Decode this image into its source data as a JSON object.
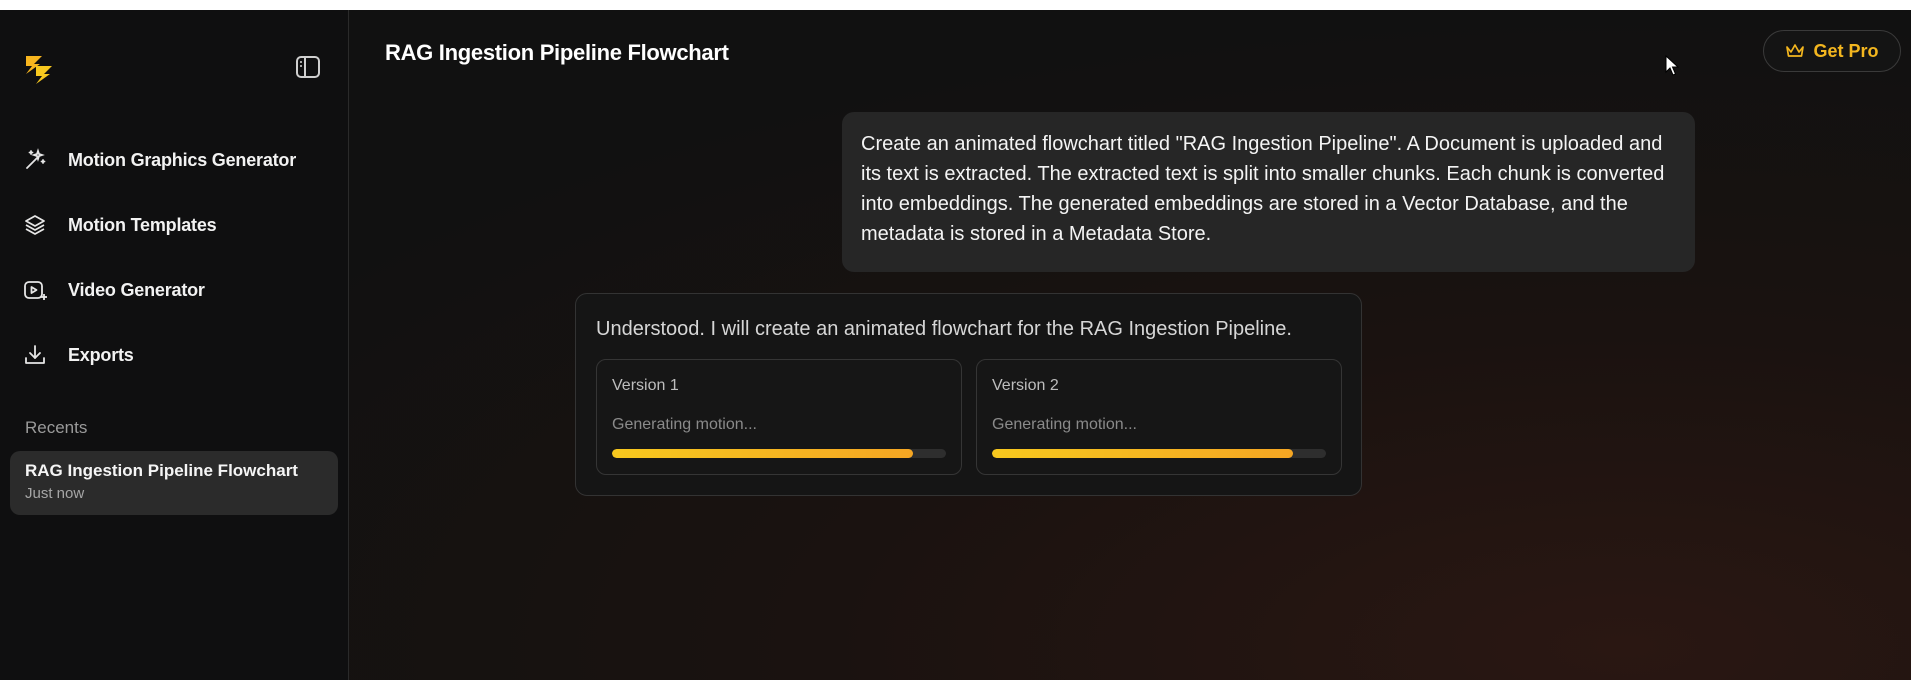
{
  "sidebar": {
    "items": [
      {
        "label": "Motion Graphics Generator",
        "icon": "magic-wand-icon"
      },
      {
        "label": "Motion Templates",
        "icon": "layers-icon"
      },
      {
        "label": "Video Generator",
        "icon": "video-play-icon"
      },
      {
        "label": "Exports",
        "icon": "download-icon"
      }
    ],
    "recents_heading": "Recents",
    "recents": [
      {
        "title": "RAG Ingestion Pipeline Flowchart",
        "time": "Just now"
      }
    ]
  },
  "header": {
    "title": "RAG Ingestion Pipeline Flowchart",
    "get_pro_label": "Get Pro"
  },
  "chat": {
    "user_message": "Create an animated flowchart titled \"RAG Ingestion Pipeline\". A Document is uploaded and its text is extracted. The extracted text is split into smaller chunks. Each chunk is converted into embeddings. The generated embeddings are stored in a Vector Database, and the metadata is stored in a Metadata Store.",
    "assistant_message": "Understood. I will create an animated flowchart for the RAG Ingestion Pipeline.",
    "versions": [
      {
        "title": "Version 1",
        "status": "Generating motion...",
        "progress": 0.9
      },
      {
        "title": "Version 2",
        "status": "Generating motion...",
        "progress": 0.9
      }
    ]
  },
  "colors": {
    "accent": "#f5b71f",
    "background": "#121212",
    "sidebar": "#0f0f10",
    "card": "#262626"
  }
}
